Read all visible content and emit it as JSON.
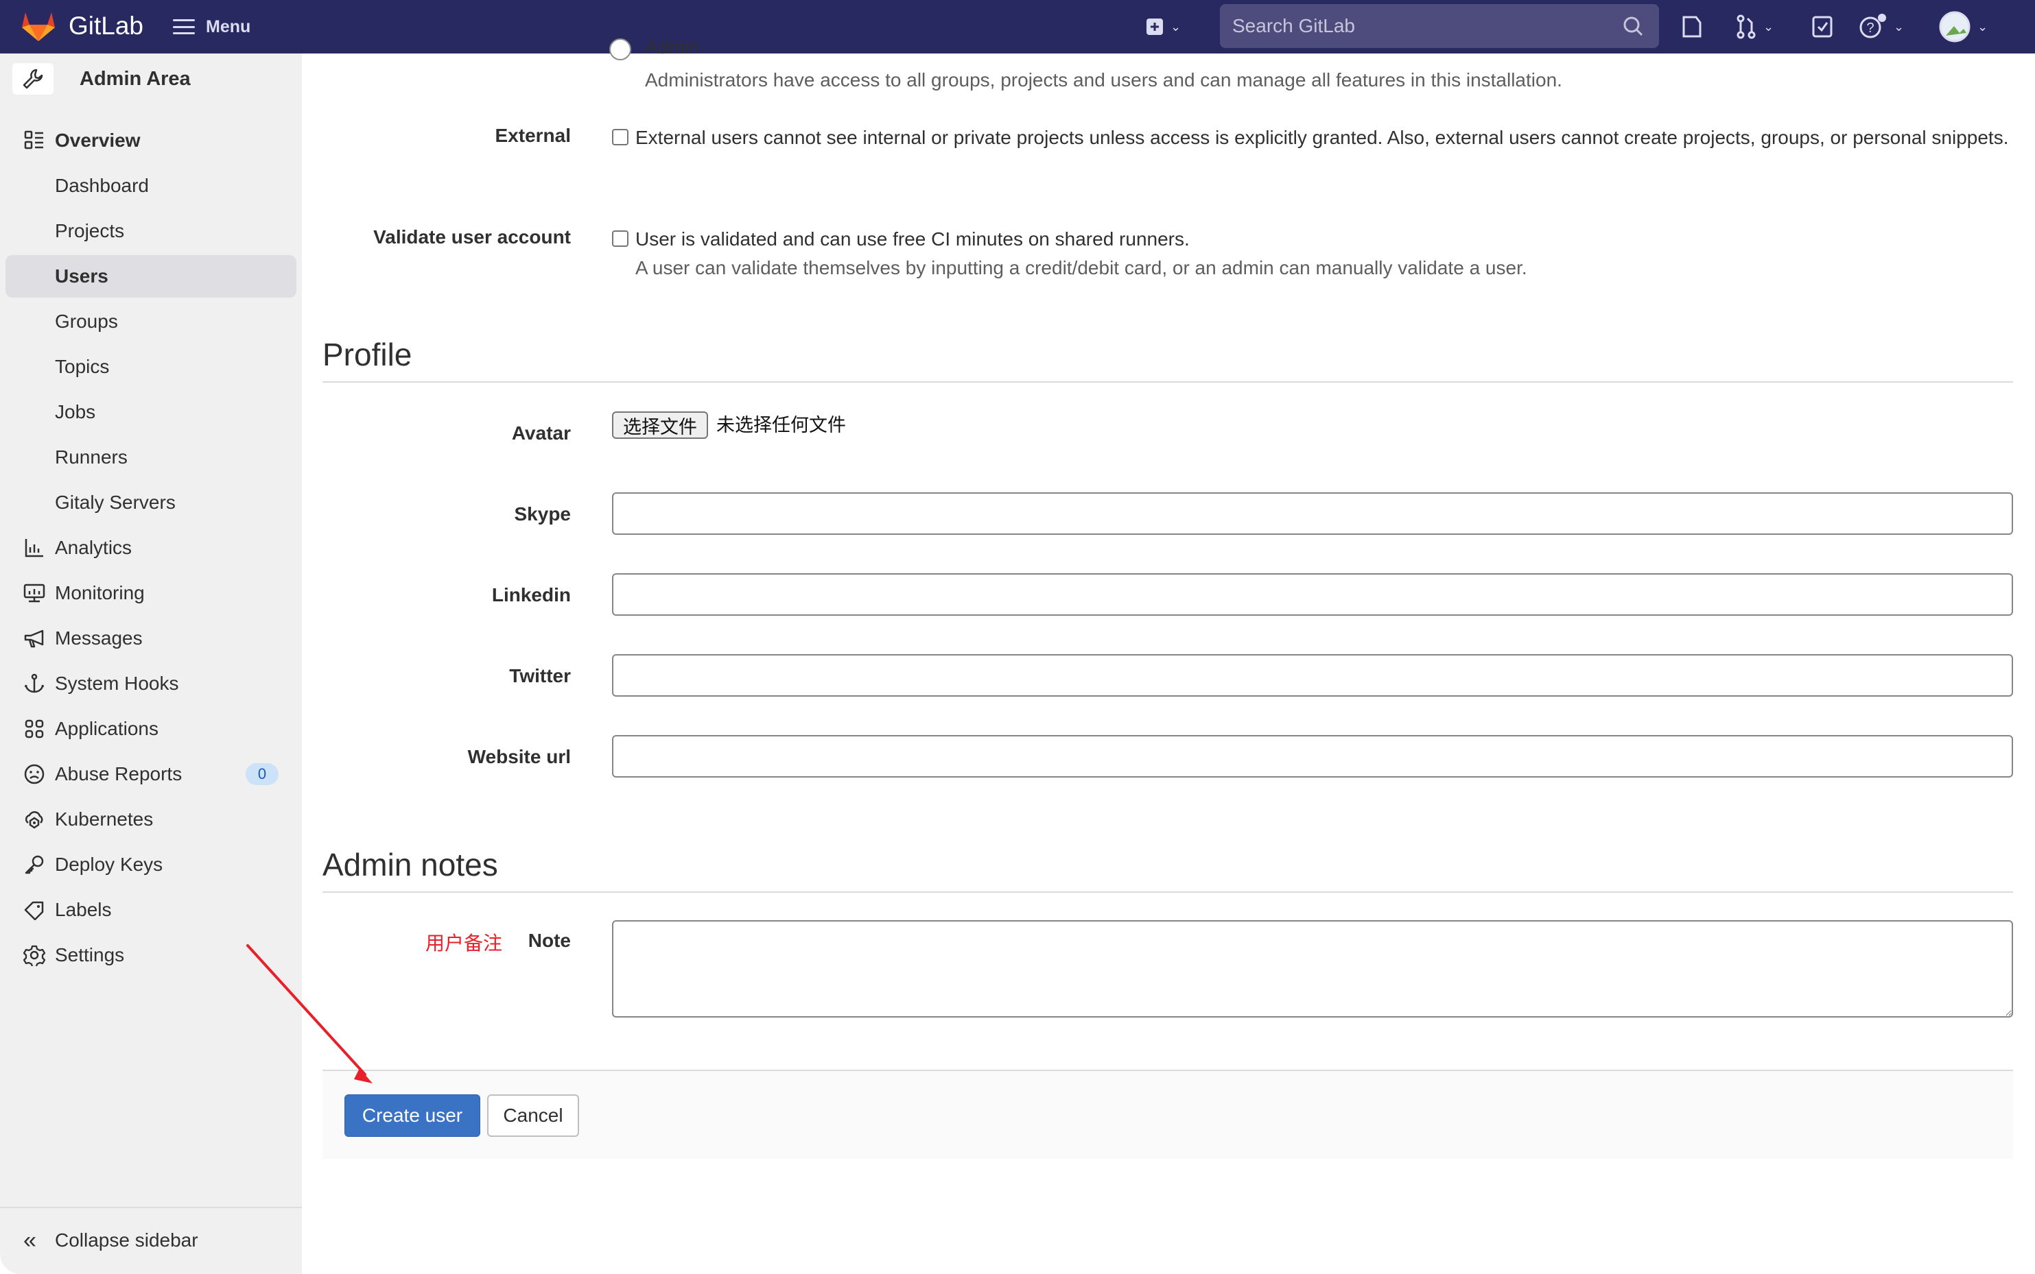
{
  "topbar": {
    "brand": "GitLab",
    "menu_label": "Menu",
    "search_placeholder": "Search GitLab",
    "icons": [
      "new-item-icon",
      "search-icon",
      "issues-icon",
      "merge-requests-icon",
      "todos-icon",
      "help-icon",
      "user-avatar"
    ]
  },
  "sidebar": {
    "title": "Admin Area",
    "title_icon": "wrench-icon",
    "items": [
      {
        "label": "Overview",
        "icon": "overview-icon",
        "type": "section"
      },
      {
        "label": "Dashboard",
        "type": "sub"
      },
      {
        "label": "Projects",
        "type": "sub"
      },
      {
        "label": "Users",
        "type": "sub",
        "active": true
      },
      {
        "label": "Groups",
        "type": "sub"
      },
      {
        "label": "Topics",
        "type": "sub"
      },
      {
        "label": "Jobs",
        "type": "sub"
      },
      {
        "label": "Runners",
        "type": "sub"
      },
      {
        "label": "Gitaly Servers",
        "type": "sub"
      },
      {
        "label": "Analytics",
        "icon": "chart-icon"
      },
      {
        "label": "Monitoring",
        "icon": "monitor-icon"
      },
      {
        "label": "Messages",
        "icon": "bullhorn-icon"
      },
      {
        "label": "System Hooks",
        "icon": "anchor-icon"
      },
      {
        "label": "Applications",
        "icon": "applications-icon"
      },
      {
        "label": "Abuse Reports",
        "icon": "sad-face-icon",
        "badge": "0"
      },
      {
        "label": "Kubernetes",
        "icon": "kubernetes-icon"
      },
      {
        "label": "Deploy Keys",
        "icon": "key-icon"
      },
      {
        "label": "Labels",
        "icon": "label-icon"
      },
      {
        "label": "Settings",
        "icon": "settings-icon"
      }
    ],
    "collapse_label": "Collapse sidebar"
  },
  "form": {
    "admin_option": {
      "label": "Admin",
      "help": "Administrators have access to all groups, projects and users and can manage all features in this installation.",
      "checked": false
    },
    "external": {
      "label": "External",
      "text": "External users cannot see internal or private projects unless access is explicitly granted. Also, external users cannot create projects, groups, or personal snippets.",
      "checked": false
    },
    "validate": {
      "label": "Validate user account",
      "text": "User is validated and can use free CI minutes on shared runners.",
      "help": "A user can validate themselves by inputting a credit/debit card, or an admin can manually validate a user.",
      "checked": false
    },
    "profile": {
      "heading": "Profile",
      "avatar_label": "Avatar",
      "file_button": "选择文件",
      "file_status": "未选择任何文件",
      "skype_label": "Skype",
      "skype_value": "",
      "linkedin_label": "Linkedin",
      "linkedin_value": "",
      "twitter_label": "Twitter",
      "twitter_value": "",
      "website_label": "Website url",
      "website_value": ""
    },
    "admin_notes": {
      "heading": "Admin notes",
      "note_label": "Note",
      "note_value": "",
      "annotation": "用户备注"
    },
    "actions": {
      "create_label": "Create user",
      "cancel_label": "Cancel"
    }
  },
  "colors": {
    "topbar": "#292961",
    "primary": "#3a72c4",
    "annotation": "#e8202a"
  }
}
